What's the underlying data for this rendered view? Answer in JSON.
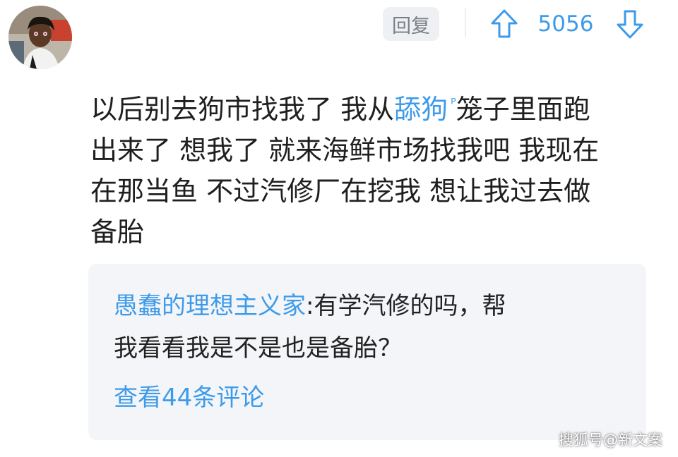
{
  "avatar": {
    "icon": "user-avatar-image"
  },
  "actions": {
    "reply_label": "回复",
    "upvote_count": "5056",
    "upvote_icon": "arrow-up-icon",
    "downvote_icon": "arrow-down-icon",
    "accent_color": "#3d9be9"
  },
  "comment": {
    "line1_a": "以后别去狗市找我了 我从",
    "line1_keyword": "舔狗",
    "line1_badge": "ᴾ",
    "line1_b": "笼子里面跑",
    "line2": "出来了 想我了 就来海鲜市场找我吧 我现在",
    "line3": "在那当鱼 不过汽修厂在挖我 想让我过去做",
    "line4": "备胎"
  },
  "reply": {
    "author": "愚蠢的理想主义家",
    "separator": ":",
    "text_line1": "有学汽修的吗，帮",
    "text_line2": "我看看我是不是也是备胎？",
    "view_comments": "查看44条评论"
  },
  "watermark": "搜狐号@新文案"
}
